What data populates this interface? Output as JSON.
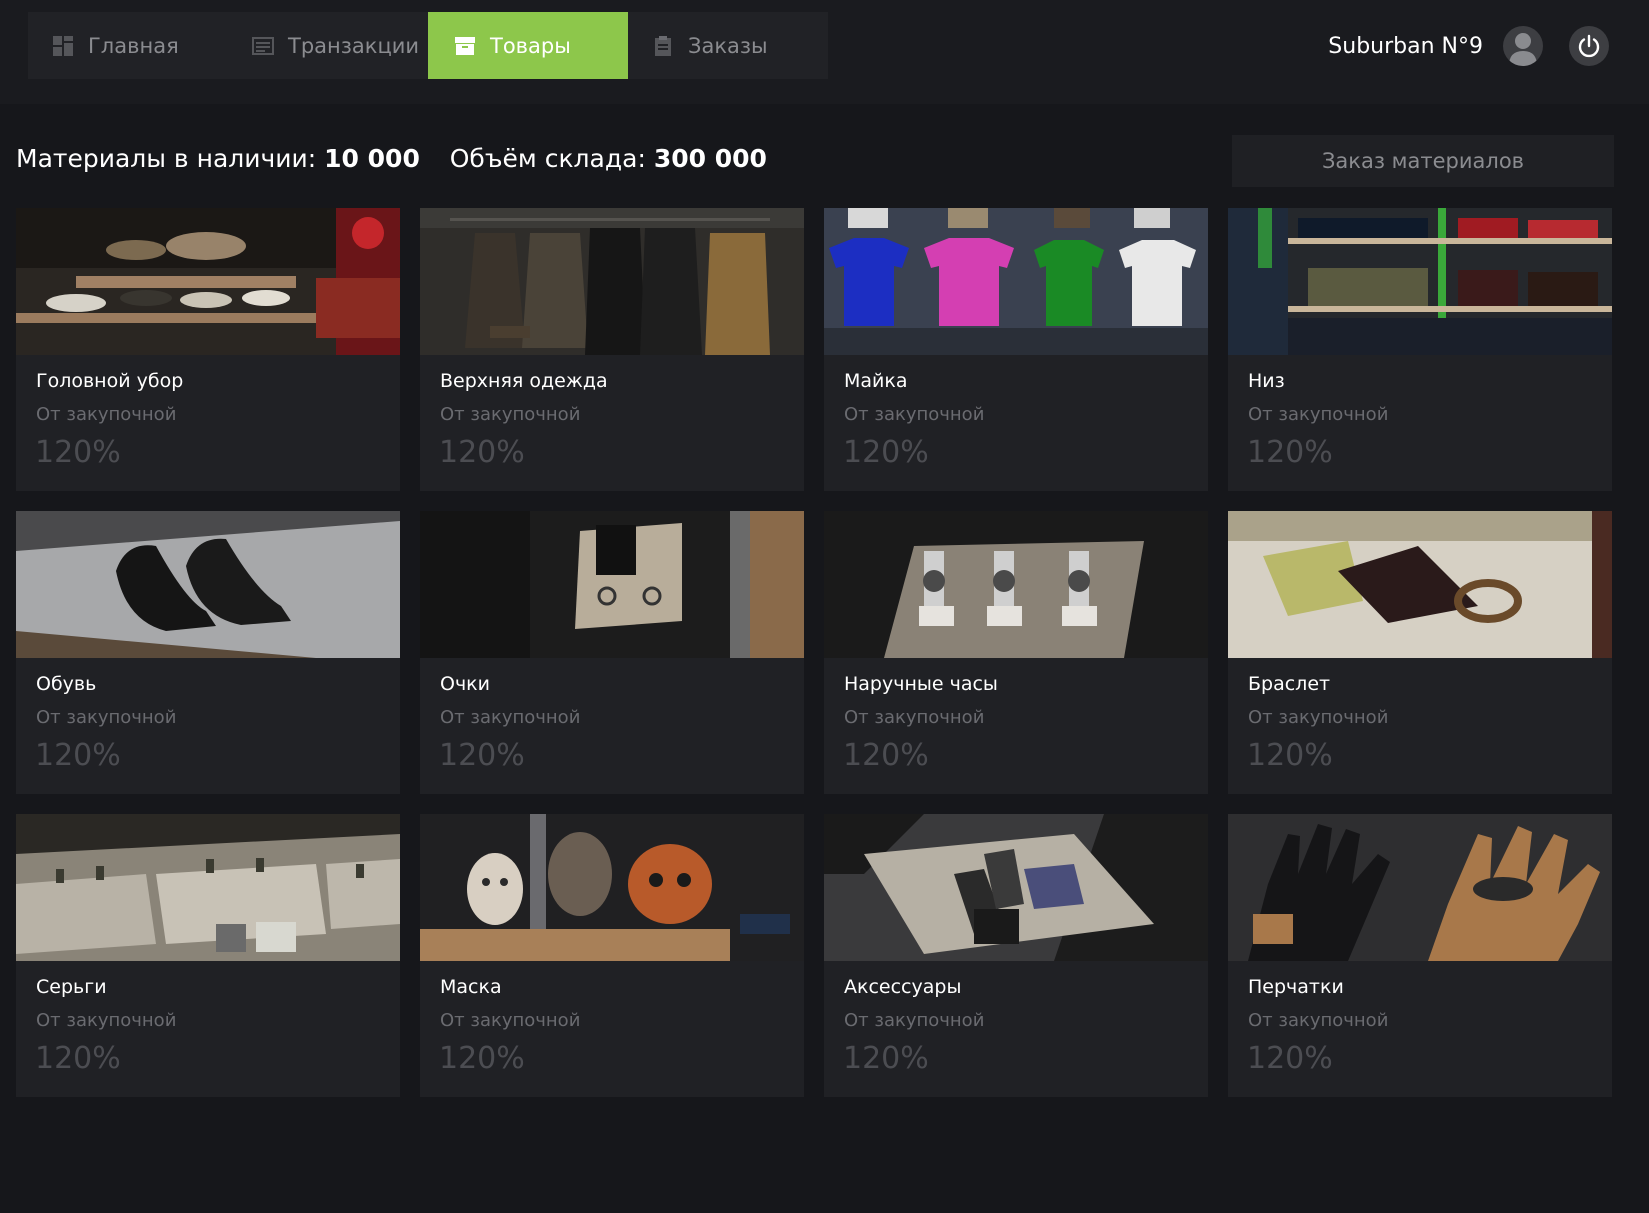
{
  "nav": {
    "tabs": [
      {
        "label": "Главная",
        "icon": "dashboard-icon",
        "active": false
      },
      {
        "label": "Транзакции",
        "icon": "list-icon",
        "active": false
      },
      {
        "label": "Товары",
        "icon": "box-icon",
        "active": true
      },
      {
        "label": "Заказы",
        "icon": "clipboard-icon",
        "active": false
      }
    ]
  },
  "user": {
    "name": "Suburban N°9",
    "avatar_icon": "user-icon",
    "power_icon": "power-icon"
  },
  "stats": {
    "materials_label": "Материалы в наличии:",
    "materials_value": "10 000",
    "capacity_label": "Объём склада:",
    "capacity_value": "300 000"
  },
  "order_button": "Заказ материалов",
  "products": [
    {
      "title": "Головной убор",
      "subtitle": "От закупочной",
      "percent": "120%"
    },
    {
      "title": "Верхняя одежда",
      "subtitle": "От закупочной",
      "percent": "120%"
    },
    {
      "title": "Майка",
      "subtitle": "От закупочной",
      "percent": "120%"
    },
    {
      "title": "Низ",
      "subtitle": "От закупочной",
      "percent": "120%"
    },
    {
      "title": "Обувь",
      "subtitle": "От закупочной",
      "percent": "120%"
    },
    {
      "title": "Очки",
      "subtitle": "От закупочной",
      "percent": "120%"
    },
    {
      "title": "Наручные часы",
      "subtitle": "От закупочной",
      "percent": "120%"
    },
    {
      "title": "Браслет",
      "subtitle": "От закупочной",
      "percent": "120%"
    },
    {
      "title": "Серьги",
      "subtitle": "От закупочной",
      "percent": "120%"
    },
    {
      "title": "Маска",
      "subtitle": "От закупочной",
      "percent": "120%"
    },
    {
      "title": "Аксессуары",
      "subtitle": "От закупочной",
      "percent": "120%"
    },
    {
      "title": "Перчатки",
      "subtitle": "От закупочной",
      "percent": "120%"
    }
  ],
  "colors": {
    "accent": "#8dc74b",
    "background": "#16171b",
    "card": "#202125",
    "muted_text": "#6a6b70"
  }
}
